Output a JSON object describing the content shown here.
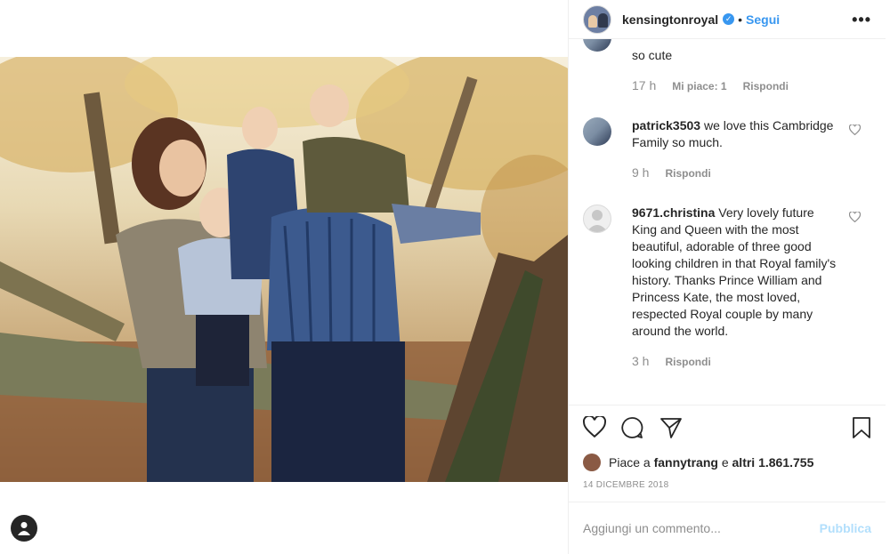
{
  "post": {
    "username": "kensingtonroyal",
    "separator": "•",
    "follow_label": "Segui",
    "more_label": "•••"
  },
  "comments": [
    {
      "text": "so cute",
      "time": "17 h",
      "likes": "Mi piace: 1",
      "reply": "Rispondi"
    },
    {
      "user": "patrick3503",
      "text": "we love this Cambridge Family so much.",
      "time": "9 h",
      "reply": "Rispondi"
    },
    {
      "user": "9671.christina",
      "text": "Very lovely future King and Queen with the most beautiful, adorable of three good looking children in that Royal family's history. Thanks Prince William and Princess Kate, the most loved, respected Royal couple by many around the world.",
      "time": "3 h",
      "reply": "Rispondi"
    }
  ],
  "likes": {
    "prefix": "Piace a",
    "user": "fannytrang",
    "conj": "e",
    "others": "altri 1.861.755"
  },
  "date": "14 DICEMBRE 2018",
  "add_comment": {
    "placeholder": "Aggiungi un commento...",
    "publish_label": "Pubblica"
  },
  "colors": {
    "link": "#3897f0",
    "muted": "#8e8e8e",
    "publish_disabled": "#b2dffc",
    "text": "#262626"
  },
  "icons": [
    "verified-badge-icon",
    "more-options-icon",
    "heart-icon",
    "comment-icon",
    "share-icon",
    "bookmark-icon",
    "account-icon"
  ]
}
